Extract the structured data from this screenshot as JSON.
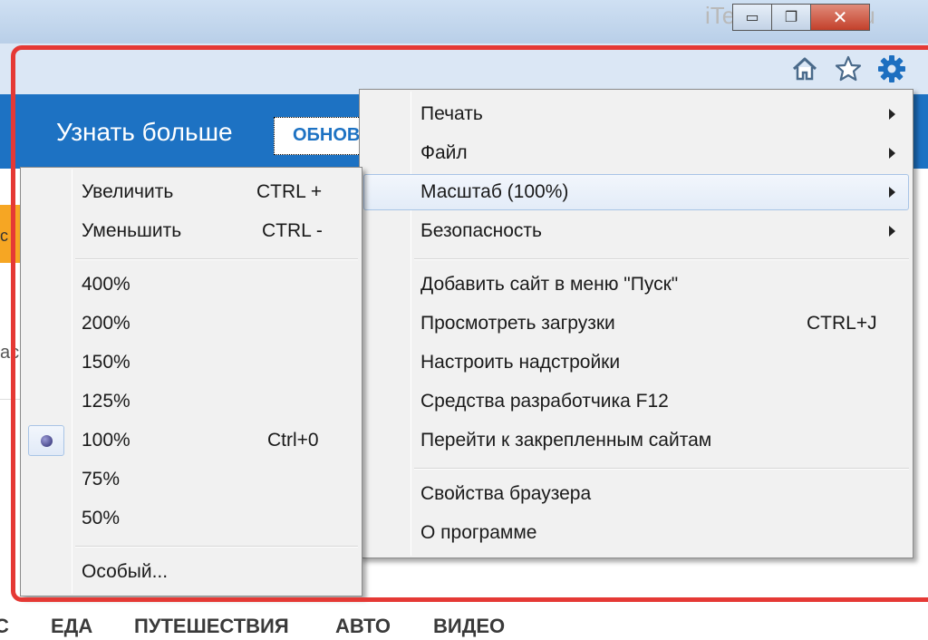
{
  "window": {
    "watermark": "iTech-Master.Ru",
    "minimize_glyph": "▭",
    "restore_glyph": "❐",
    "close_glyph": "✕"
  },
  "toolbar": {
    "icons": [
      "home-icon",
      "star-icon",
      "gear-icon"
    ],
    "accent_color": "#1d72c3"
  },
  "page": {
    "learn_more": "Узнать больше",
    "update_button": "ОБНОВИТЬ",
    "side_fragment_1": "с",
    "side_fragment_2": "ас",
    "bottom_nav": [
      "С",
      "ЕДА",
      "ПУТЕШЕСТВИЯ",
      "АВТО",
      "ВИДЕО"
    ]
  },
  "main_menu": {
    "items": [
      {
        "label": "Печать",
        "submenu": true
      },
      {
        "label": "Файл",
        "submenu": true
      },
      {
        "label": "Масштаб (100%)",
        "submenu": true,
        "highlighted": true
      },
      {
        "label": "Безопасность",
        "submenu": true
      },
      {
        "label": "Добавить сайт в меню \"Пуск\""
      },
      {
        "label": "Просмотреть загрузки",
        "shortcut": "CTRL+J"
      },
      {
        "label": "Настроить надстройки"
      },
      {
        "label": "Средства разработчика F12"
      },
      {
        "label": "Перейти к закрепленным сайтам"
      },
      {
        "label": "Свойства браузера"
      },
      {
        "label": "О программе"
      }
    ]
  },
  "zoom_menu": {
    "zoom_in": {
      "label": "Увеличить",
      "shortcut": "CTRL +"
    },
    "zoom_out": {
      "label": "Уменьшить",
      "shortcut": "CTRL -"
    },
    "levels": [
      {
        "label": "400%"
      },
      {
        "label": "200%"
      },
      {
        "label": "150%"
      },
      {
        "label": "125%"
      },
      {
        "label": "100%",
        "shortcut": "Ctrl+0",
        "selected": true
      },
      {
        "label": "75%"
      },
      {
        "label": "50%"
      }
    ],
    "custom": "Особый..."
  }
}
